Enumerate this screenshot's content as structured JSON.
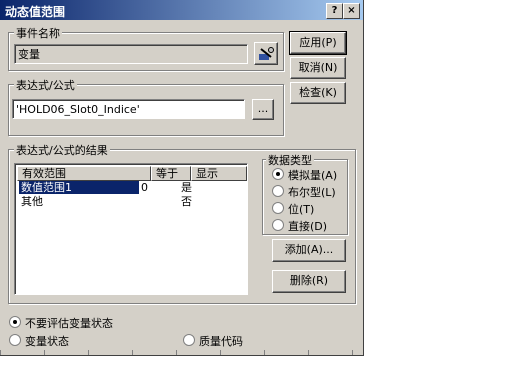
{
  "window": {
    "title": "动态值范围",
    "help_btn": "?",
    "close_btn": "×"
  },
  "event_name": {
    "label": "事件名称",
    "value": "变量"
  },
  "expression": {
    "label": "表达式/公式",
    "value": "'HOLD06_Slot0_Indice'",
    "browse_label": "..."
  },
  "results": {
    "label": "表达式/公式的结果",
    "columns": [
      "有效范围",
      "等于",
      "显示"
    ],
    "rows": [
      {
        "range": "数值范围1",
        "equals": "0",
        "display": "是"
      },
      {
        "range": "其他",
        "equals": "",
        "display": "否"
      }
    ]
  },
  "data_type": {
    "label": "数据类型",
    "options": [
      "模拟量(A)",
      "布尔型(L)",
      "位(T)",
      "直接(D)"
    ],
    "selected": 0
  },
  "buttons": {
    "apply": "应用(P)",
    "cancel": "取消(N)",
    "check": "检查(K)",
    "add": "添加(A)...",
    "delete": "删除(R)"
  },
  "options": {
    "no_eval": "不要评估变量状态",
    "var_state": "变量状态",
    "quality_code": "质量代码"
  }
}
